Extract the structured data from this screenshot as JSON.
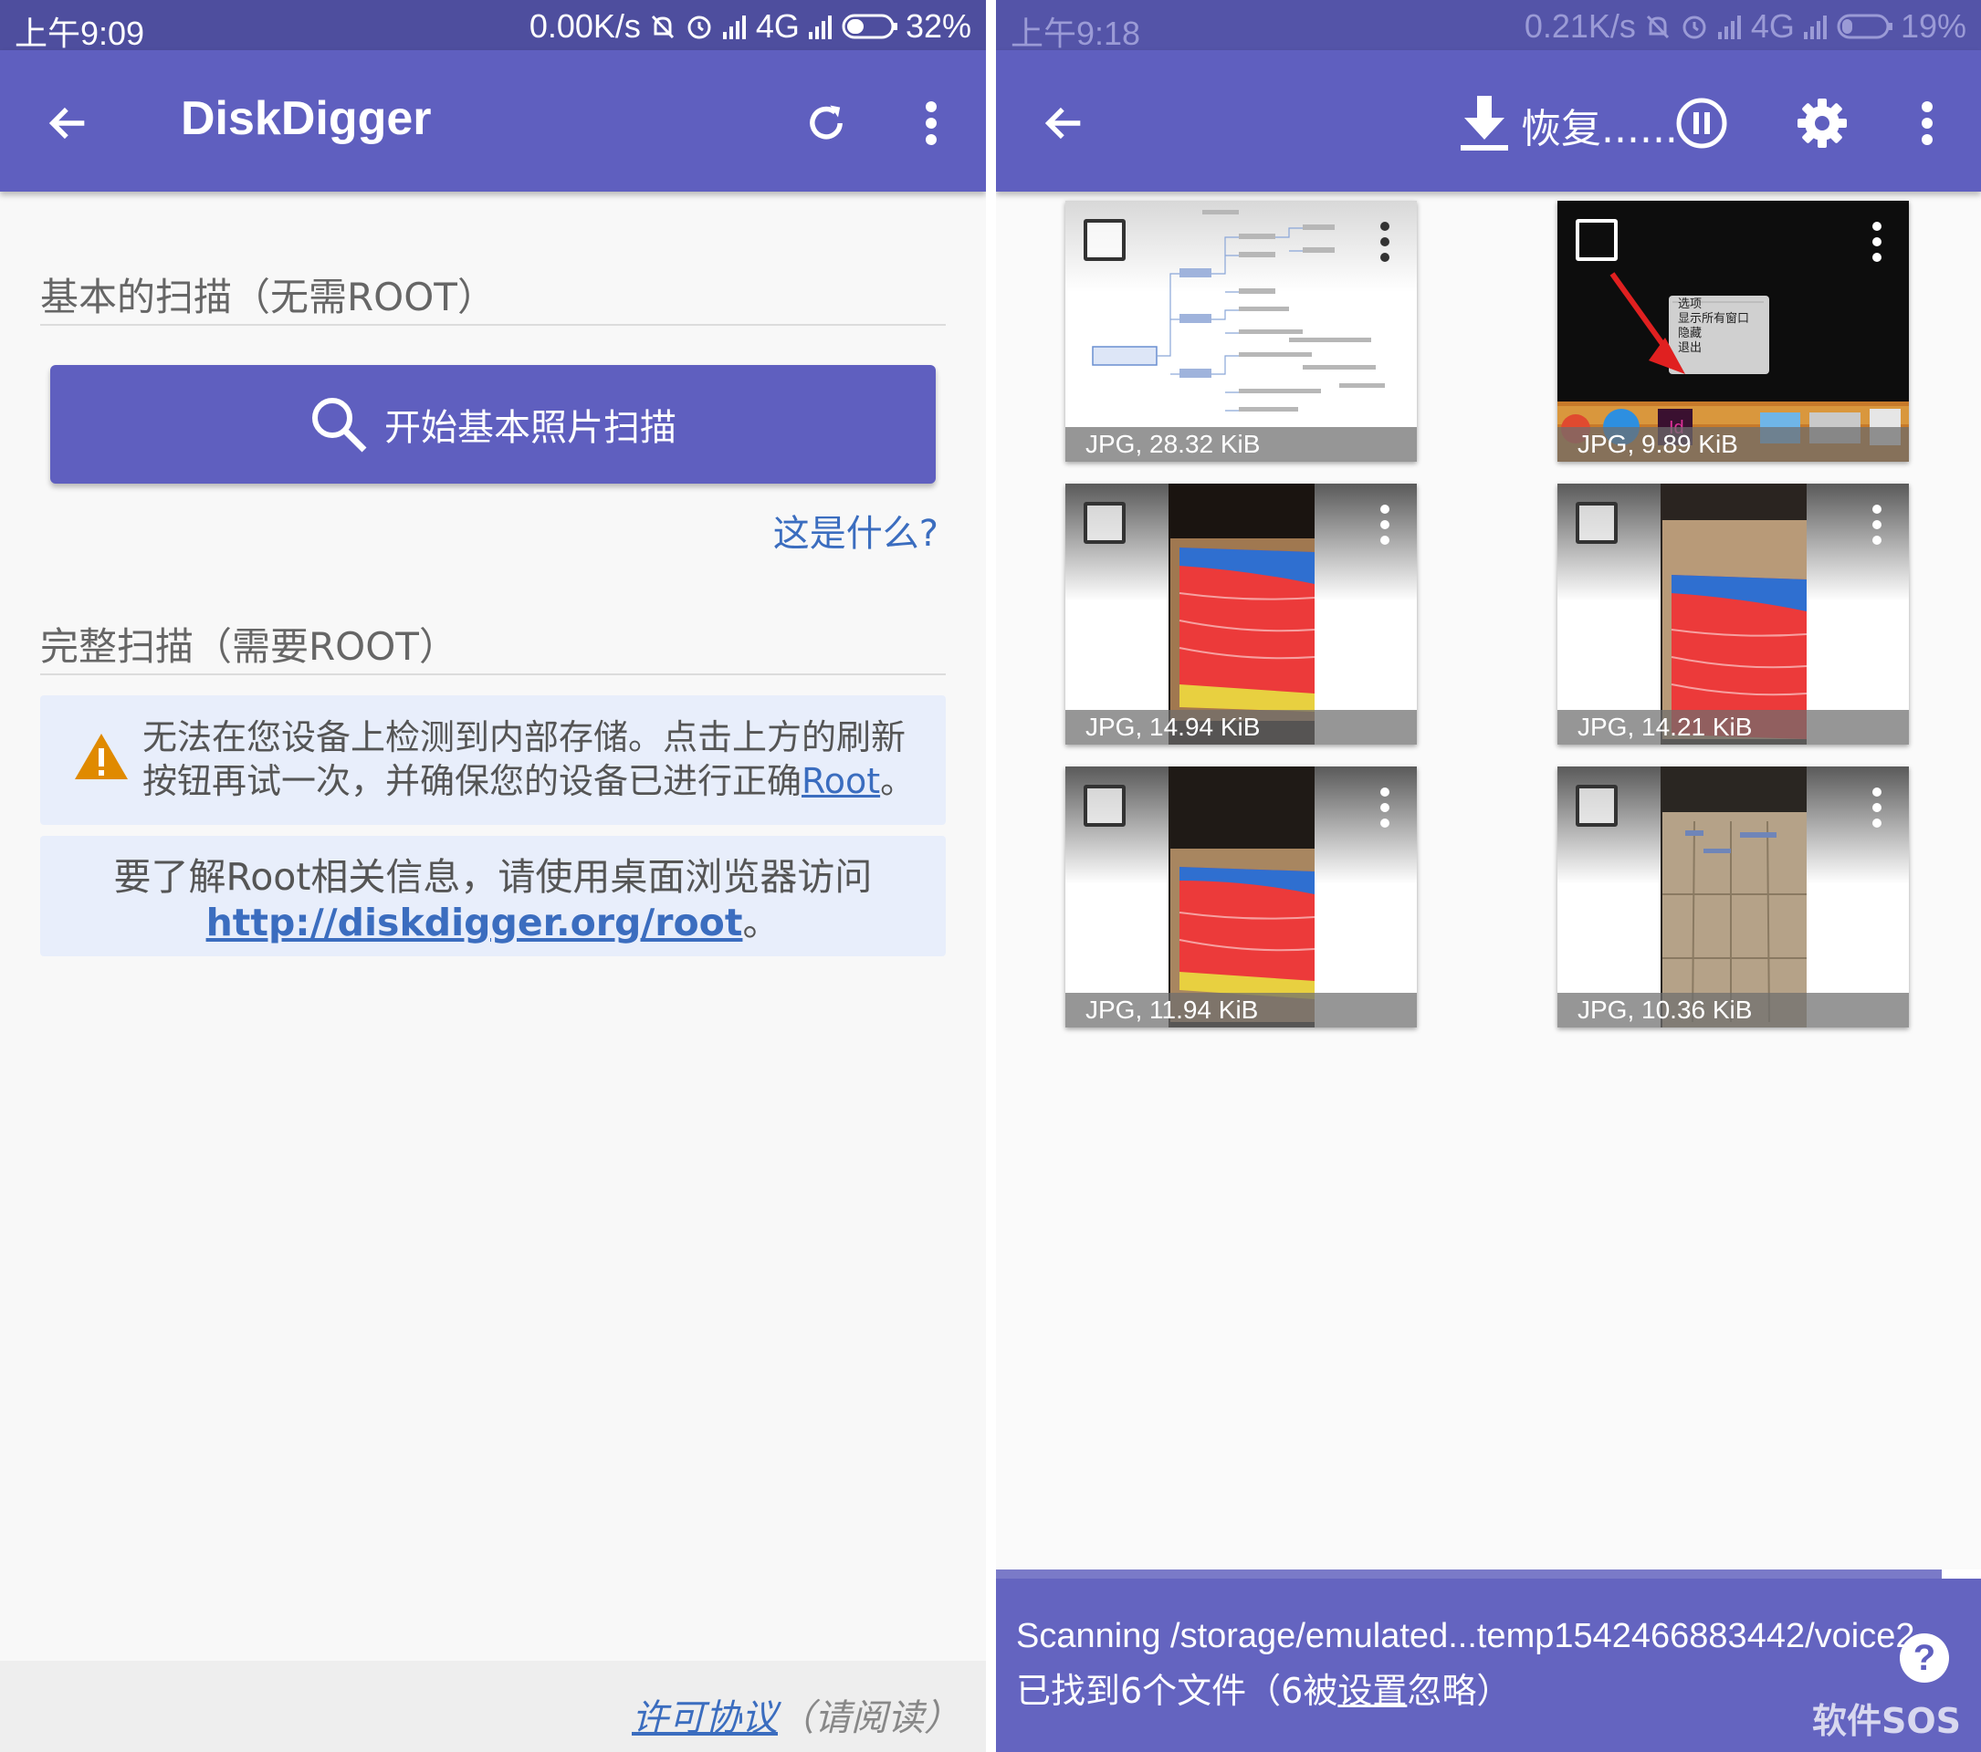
{
  "left": {
    "status": {
      "time": "上午9:09",
      "speed": "0.00K/s",
      "network": "4G",
      "battery": "32%"
    },
    "appbar": {
      "title": "DiskDigger"
    },
    "basic_scan": {
      "header": "基本的扫描（无需ROOT）",
      "button_label": "开始基本照片扫描",
      "whatis_link": "这是什么?"
    },
    "full_scan": {
      "header": "完整扫描（需要ROOT）",
      "warning_text": "无法在您设备上检测到内部存储。点击上方的刷新按钮再试一次，并确保您的设备已进行正确",
      "warning_link": "Root",
      "warning_end": "。",
      "info_text": "要了解Root相关信息，请使用桌面浏览器访问",
      "info_link": "http://diskdigger.org/root",
      "info_end": "。"
    },
    "footer": {
      "license_link": "许可协议",
      "license_note": "（请阅读）"
    }
  },
  "right": {
    "status": {
      "time": "上午9:18",
      "speed": "0.21K/s",
      "network": "4G",
      "battery": "19%"
    },
    "appbar": {
      "recover_label": "恢复......"
    },
    "thumbnails": [
      {
        "caption": "JPG, 28.32 KiB",
        "kind": "mindmap"
      },
      {
        "caption": "JPG, 9.89 KiB",
        "kind": "desktop",
        "menu": {
          "item1": "选项",
          "item2": "显示所有窗口",
          "item3": "隐藏",
          "item4": "退出"
        }
      },
      {
        "caption": "JPG, 14.94 KiB",
        "kind": "screen-photo"
      },
      {
        "caption": "JPG, 14.21 KiB",
        "kind": "screen-photo"
      },
      {
        "caption": "JPG, 11.94 KiB",
        "kind": "screen-photo"
      },
      {
        "caption": "JPG, 10.36 KiB",
        "kind": "paper-photo"
      }
    ],
    "scan": {
      "progress": 0.96,
      "path": "Scanning /storage/emulated...temp1542466883442/voice2",
      "found_text": "已找到6个文件（6被",
      "found_link": "设置",
      "found_end": "忽略）",
      "help_label": "?"
    },
    "watermark": "软件SOS"
  },
  "colors": {
    "primary": "#5f5fbf",
    "statusbar": "#4e4e9e",
    "link": "#3b6dbf",
    "notice_bg": "#e8eefb",
    "warning": "#e08a00"
  }
}
